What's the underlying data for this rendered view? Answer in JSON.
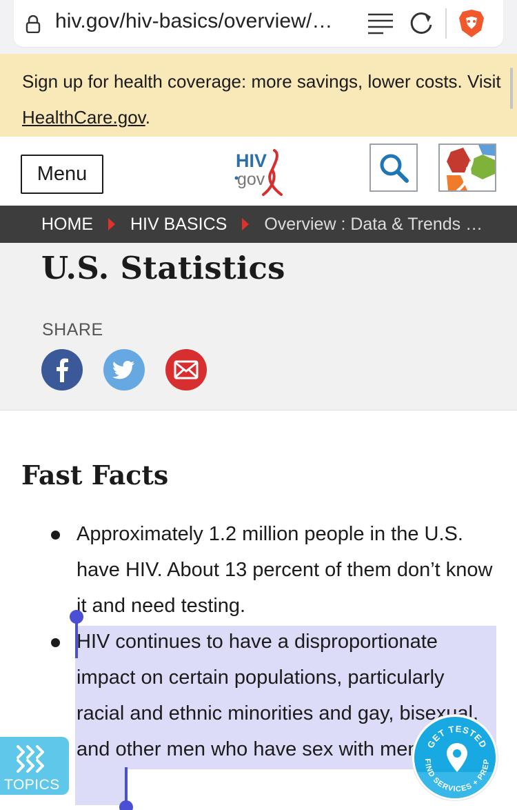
{
  "browser": {
    "url": "hiv.gov/hiv-basics/overview/…"
  },
  "banner": {
    "text": "Sign up for health coverage: more savings, lower costs. Visit ",
    "link_text": "HealthCare.gov",
    "suffix": "."
  },
  "header": {
    "menu_label": "Menu",
    "logo_text_top": "HIV",
    "logo_text_bottom": "gov"
  },
  "breadcrumb": {
    "items": [
      "HOME",
      "HIV BASICS",
      "Overview : Data & Trends …"
    ]
  },
  "page": {
    "title": "U.S. Statistics",
    "share_label": "SHARE"
  },
  "content": {
    "heading": "Fast Facts",
    "facts": [
      "Approximately 1.2 million people in the U.S. have HIV. About 13 percent of them don’t know it and need testing.",
      "HIV continues to have a disproportionate impact on certain populations, particularly racial and ethnic minorities and gay, bisexual, and other men who have sex with men."
    ]
  },
  "widgets": {
    "topics_label": "TOPICS",
    "get_tested_top": "GET TESTED",
    "get_tested_bottom": "FIND SERVICES + PREP"
  },
  "colors": {
    "banner_bg": "#f9e8b8",
    "breadcrumb_bg": "#3d3d3d",
    "accent_red": "#e0312b",
    "selection": "#4a4fd4"
  }
}
